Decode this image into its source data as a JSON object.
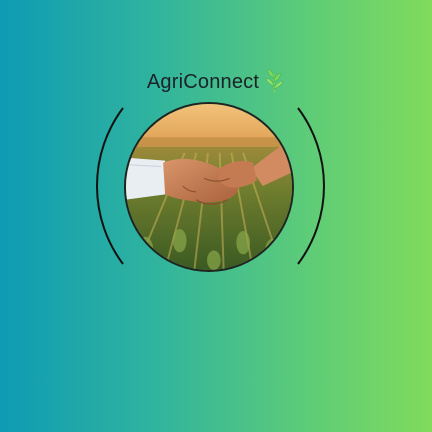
{
  "brand": {
    "name": "AgriConnect",
    "icon": "wheat-leaf-icon"
  },
  "photo": {
    "subject": "handshake-over-crop-field"
  },
  "colors": {
    "gradient_left": "#0e9bb3",
    "gradient_right": "#80db5c",
    "text": "#1a2228",
    "leaf": "#6fd05a",
    "arc": "#111111"
  }
}
